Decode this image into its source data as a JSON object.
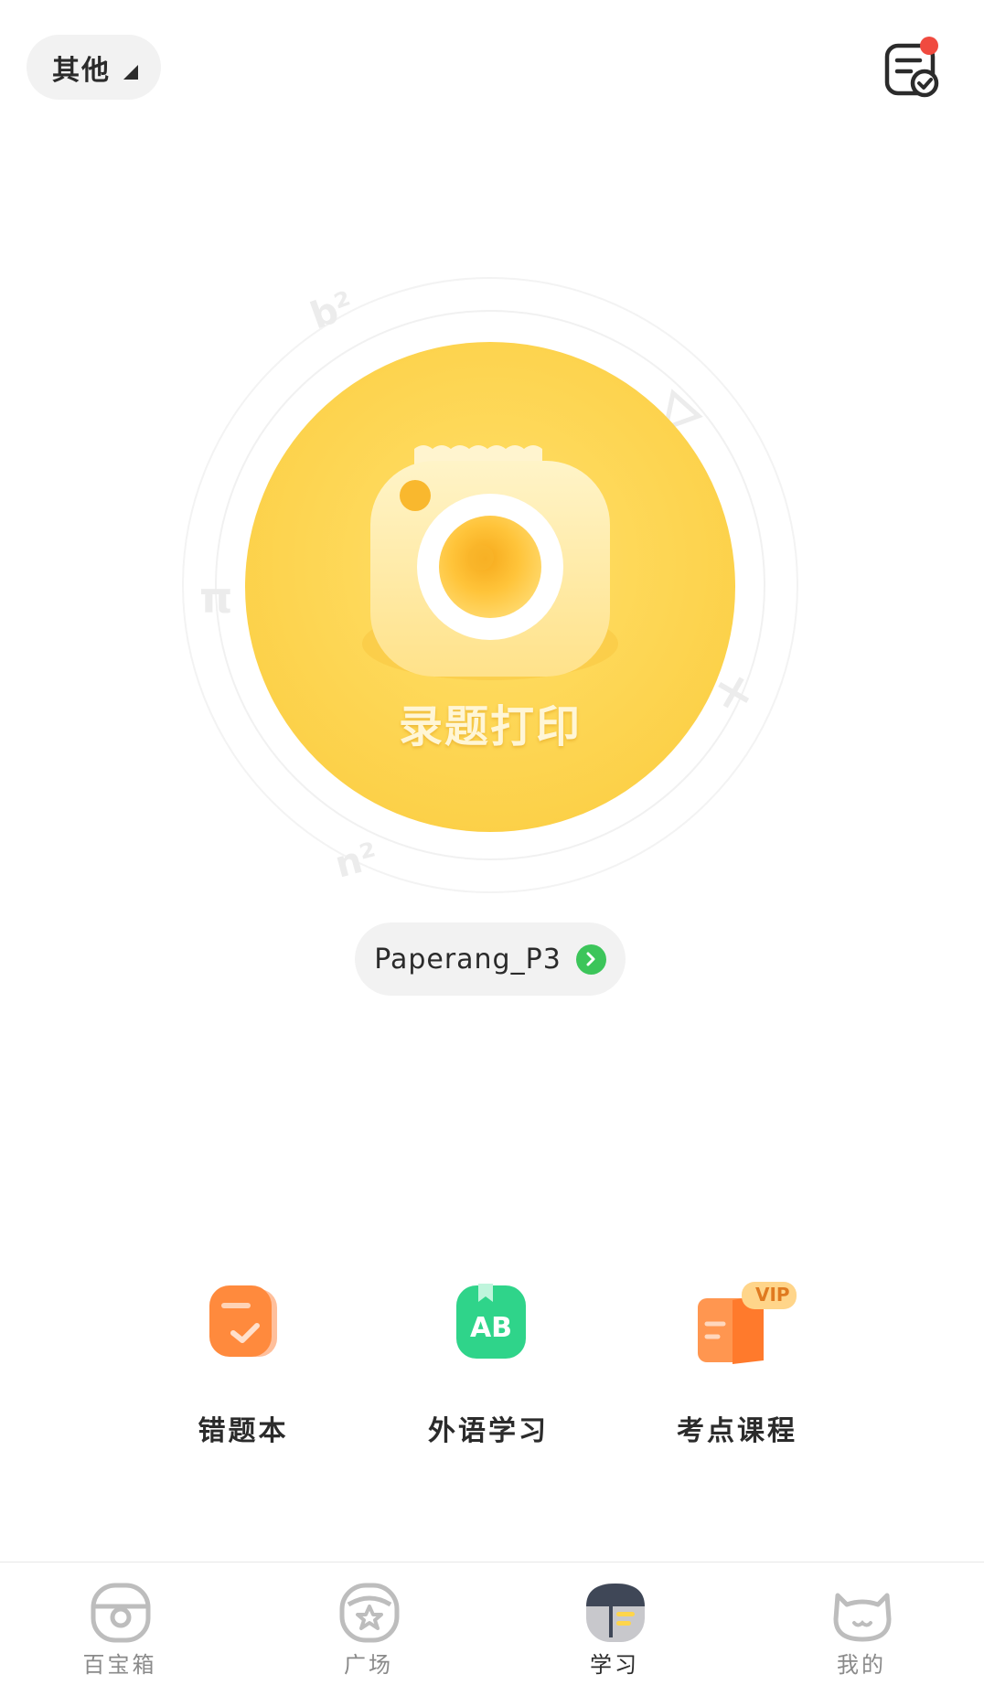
{
  "topbar": {
    "category_label": "其他",
    "task_icon": "task-list-check-icon"
  },
  "hero": {
    "label": "录题打印",
    "icon": "camera-icon",
    "background_color": "#fdd24a"
  },
  "device": {
    "name": "Paperang_P3",
    "arrow_icon": "chevron-right-icon"
  },
  "features": [
    {
      "label": "错题本",
      "icon": "mistake-book-icon"
    },
    {
      "label": "外语学习",
      "icon": "ab-book-icon"
    },
    {
      "label": "考点课程",
      "icon": "vip-course-icon",
      "badge": "VIP"
    }
  ],
  "tabbar": {
    "items": [
      {
        "label": "百宝箱",
        "icon": "toolbox-icon"
      },
      {
        "label": "广场",
        "icon": "star-plaza-icon"
      },
      {
        "label": "学习",
        "icon": "study-icon",
        "active": true
      },
      {
        "label": "我的",
        "icon": "cat-profile-icon"
      }
    ]
  },
  "colors": {
    "accent_yellow": "#fdd24a",
    "orange": "#ff8a3d",
    "green": "#2fd48a",
    "notification_red": "#f04a3f"
  }
}
